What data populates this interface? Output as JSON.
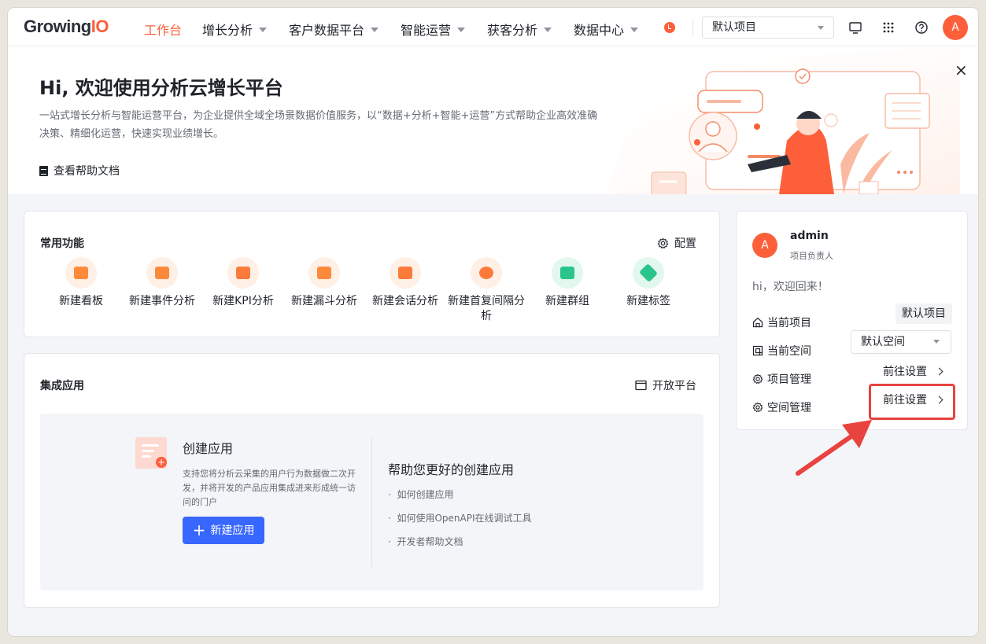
{
  "nav": {
    "logo_main": "Growing",
    "logo_io": "IO",
    "items": [
      {
        "label": "工作台",
        "active": true
      },
      {
        "label": "增长分析",
        "dropdown": true
      },
      {
        "label": "客户数据平台",
        "dropdown": true
      },
      {
        "label": "智能运营",
        "dropdown": true
      },
      {
        "label": "获客分析",
        "dropdown": true
      },
      {
        "label": "数据中心",
        "dropdown": true
      }
    ],
    "project_select": "默认项目",
    "avatar": "A",
    "icons": [
      "notification-dot-icon",
      "monitor-icon",
      "apps-grid-icon",
      "help-icon"
    ]
  },
  "banner": {
    "title": "Hi, 欢迎使用分析云增长平台",
    "description": "一站式增长分析与智能运营平台，为企业提供全域全场景数据价值服务，以“数据+分析+智能+运营”方式帮助企业高效准确决策、精细化运营，快速实现业绩增长。",
    "help_link": "查看帮助文档",
    "close": "×"
  },
  "functions": {
    "title": "常用功能",
    "config": "配置",
    "items": [
      {
        "label": "新建看板",
        "color": "#fc8a3a"
      },
      {
        "label": "新建事件分析",
        "color": "#fc8a3a"
      },
      {
        "label": "新建KPI分析",
        "color": "#fc7a3a"
      },
      {
        "label": "新建漏斗分析",
        "color": "#fc8a3a"
      },
      {
        "label": "新建会话分析",
        "color": "#fc7a3a"
      },
      {
        "label": "新建首复间隔分析",
        "color": "#fc7a3a"
      },
      {
        "label": "新建群组",
        "color": "#2bc48a"
      },
      {
        "label": "新建标签",
        "color": "#2bc48a"
      }
    ]
  },
  "apps": {
    "title": "集成应用",
    "open_platform": "开放平台",
    "create_title": "创建应用",
    "create_desc": "支持您将分析云采集的用户行为数据做二次开发，并将开发的产品应用集成进来形成统一访问的门户",
    "new_button": "新建应用",
    "help_title": "帮助您更好的创建应用",
    "help_links": [
      "如何创建应用",
      "如何使用OpenAPI在线调试工具",
      "开发者帮助文档"
    ]
  },
  "profile": {
    "avatar": "A",
    "name": "admin",
    "role": "项目负责人",
    "welcome": "hi，欢迎回来！",
    "current_project_label": "当前项目",
    "current_project_value": "默认项目",
    "current_space_label": "当前空间",
    "current_space_value": "默认空间",
    "project_mgmt_label": "项目管理",
    "space_mgmt_label": "空间管理",
    "goto_label": "前往设置"
  },
  "colors": {
    "brand": "#fc5f3a",
    "primary_button": "#3867ff",
    "annotation": "#e8433f"
  }
}
